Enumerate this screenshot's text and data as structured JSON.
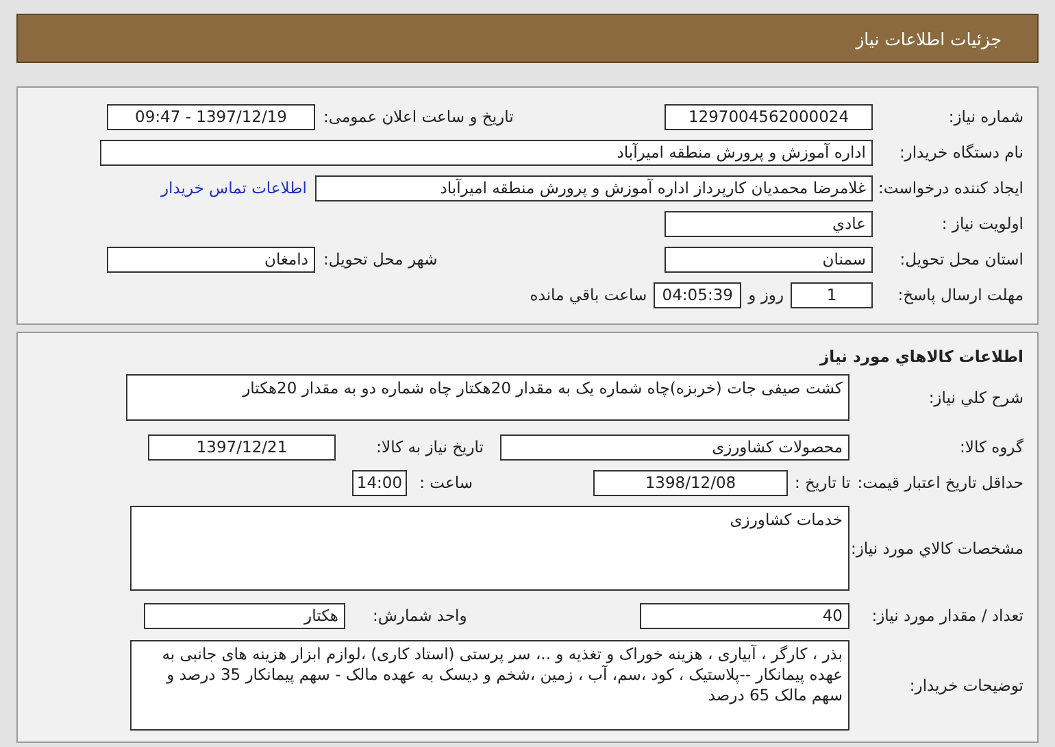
{
  "header": {
    "title": "جزئیات اطلاعات نیاز"
  },
  "request_info": {
    "need_number": {
      "label": "شماره نیاز:",
      "value": "1297004562000024"
    },
    "announce_datetime": {
      "label": "تاریخ و ساعت اعلان عمومی:",
      "value": "1397/12/19 - 09:47"
    },
    "buyer_org": {
      "label": "نام دستگاه خریدار:",
      "value": "اداره آموزش و پرورش منطقه امیرآباد"
    },
    "requester": {
      "label": "ایجاد کننده درخواست:",
      "value": "غلامرضا محمدیان کارپرداز اداره آموزش و پرورش منطقه امیرآباد",
      "contact_link": "اطلاعات تماس خریدار"
    },
    "priority": {
      "label": "اولویت نیاز :",
      "value": "عادي"
    },
    "delivery_province": {
      "label": "استان محل تحویل:",
      "value": "سمنان"
    },
    "delivery_city": {
      "label": "شهر محل تحویل:",
      "value": "دامغان"
    },
    "reply_deadline": {
      "label": "مهلت ارسال پاسخ:",
      "days": "1",
      "days_suffix": "روز و",
      "time": "04:05:39",
      "time_suffix": "ساعت باقي مانده"
    }
  },
  "goods_info": {
    "title": "اطلاعات کالاهاي مورد نیاز",
    "general_description": {
      "label": "شرح کلي نیاز:",
      "value": "کشت صیفی جات (خربزه)چاه شماره یک به مقدار 20هکتار چاه شماره دو به مقدار 20هکتار"
    },
    "goods_group": {
      "label": "گروه کالا:",
      "value": "محصولات کشاورزی"
    },
    "need_date": {
      "label": "تاریخ نیاز به کالا:",
      "value": "1397/12/21"
    },
    "price_validity": {
      "label": "حداقل تاریخ اعتبار قیمت:",
      "date_label": "تا تاریخ :",
      "date": "1398/12/08",
      "time_label": "ساعت :",
      "time": "14:00"
    },
    "specs": {
      "label": "مشخصات کالاي مورد نیاز:",
      "value": "خدمات کشاورزی"
    },
    "quantity": {
      "label": "تعداد / مقدار مورد نیاز:",
      "value": "40"
    },
    "unit": {
      "label": "واحد شمارش:",
      "value": "هکتار"
    },
    "buyer_notes": {
      "label": "توضیحات خریدار:",
      "value": "بذر ، کارگر ، آبیاری ، هزینه خوراک و تغذیه و ..، سر پرستی (استاد کاری) ،لوازم ابزار هزینه های جانبی به عهده پیمانکار --پلاستیک ، کود ،سم، آب ، زمین ،شخم و دیسک به عهده مالک  - سهم پیمانکار 35 درصد و سهم مالک 65 درصد"
    }
  }
}
